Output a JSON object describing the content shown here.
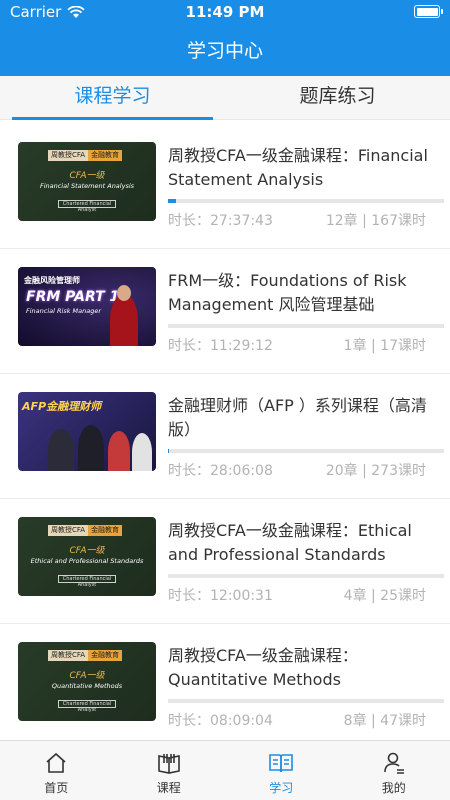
{
  "status_bar": {
    "carrier": "Carrier",
    "time": "11:49 PM"
  },
  "header": {
    "title": "学习中心"
  },
  "tabs": [
    {
      "label": "课程学习",
      "active": true
    },
    {
      "label": "题库练习",
      "active": false
    }
  ],
  "courses": [
    {
      "title": "周教授CFA一级金融课程：Financial Statement Analysis",
      "progress": 0.03,
      "duration": "时长：27:37:43",
      "count": "12章 | 167课时",
      "thumb": {
        "tag_a": "周教授CFA",
        "tag_b": "金融教育",
        "level": "CFA一级",
        "subtitle": "Financial Statement Analysis",
        "footer": "Chartered Financial Analyst"
      }
    },
    {
      "title": "FRM一级：Foundations of Risk Management 风险管理基础",
      "progress": 0,
      "duration": "时长：11:29:12",
      "count": "1章 | 17课时",
      "thumb": {
        "small": "金融风险管理师",
        "big": "FRM PART 1",
        "subtitle": "Financial Risk Manager"
      }
    },
    {
      "title": "金融理财师（AFP ）系列课程（高清版）",
      "progress": 0.005,
      "duration": "时长：28:06:08",
      "count": "20章 | 273课时",
      "thumb": {
        "big": "AFP金融理财师"
      }
    },
    {
      "title": "周教授CFA一级金融课程：Ethical and Professional Standards",
      "progress": 0,
      "duration": "时长：12:00:31",
      "count": "4章 | 25课时",
      "thumb": {
        "tag_a": "周教授CFA",
        "tag_b": "金融教育",
        "level": "CFA一级",
        "subtitle": "Ethical and Professional Standards",
        "footer": "Chartered Financial Analyst"
      }
    },
    {
      "title": "周教授CFA一级金融课程：Quantitative Methods",
      "progress": 0,
      "duration": "时长：08:09:04",
      "count": "8章 | 47课时",
      "thumb": {
        "tag_a": "周教授CFA",
        "tag_b": "金融教育",
        "level": "CFA一级",
        "subtitle": "Quantitative Methods",
        "footer": "Chartered Financial Analyst"
      }
    }
  ],
  "tabbar": [
    {
      "label": "首页",
      "icon": "home-icon",
      "active": false
    },
    {
      "label": "课程",
      "icon": "book-icon",
      "active": false
    },
    {
      "label": "学习",
      "icon": "open-book-icon",
      "active": true
    },
    {
      "label": "我的",
      "icon": "profile-icon",
      "active": false
    }
  ],
  "colors": {
    "accent": "#1a8ee6",
    "muted": "#b3b3b3"
  }
}
